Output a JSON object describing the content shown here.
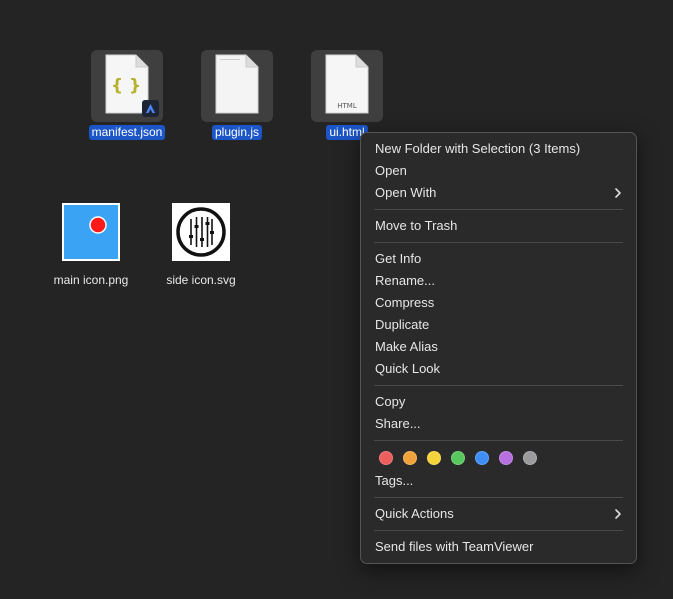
{
  "desktop": {
    "files": [
      {
        "name": "manifest.json",
        "selected": true
      },
      {
        "name": "plugin.js",
        "selected": true
      },
      {
        "name": "ui.html",
        "selected": true,
        "icon_text": "HTML"
      },
      {
        "name": "main icon.png",
        "selected": false
      },
      {
        "name": "side icon.svg",
        "selected": false
      }
    ],
    "manifest_glyph": "{ }"
  },
  "context_menu": {
    "group1": [
      {
        "label": "New Folder with Selection (3 Items)"
      },
      {
        "label": "Open"
      },
      {
        "label": "Open With",
        "submenu": true
      }
    ],
    "group2": [
      {
        "label": "Move to Trash"
      }
    ],
    "group3": [
      {
        "label": "Get Info"
      },
      {
        "label": "Rename..."
      },
      {
        "label": "Compress"
      },
      {
        "label": "Duplicate"
      },
      {
        "label": "Make Alias"
      },
      {
        "label": "Quick Look"
      }
    ],
    "group4": [
      {
        "label": "Copy"
      },
      {
        "label": "Share..."
      }
    ],
    "tag_colors": [
      {
        "name": "red",
        "color": "#ec5f5d"
      },
      {
        "name": "orange",
        "color": "#f0a33a"
      },
      {
        "name": "yellow",
        "color": "#f5d33a"
      },
      {
        "name": "green",
        "color": "#58c85e"
      },
      {
        "name": "blue",
        "color": "#3f8ef5"
      },
      {
        "name": "purple",
        "color": "#b86fe0"
      },
      {
        "name": "gray",
        "color": "#9b9b9d"
      }
    ],
    "tags_label": "Tags...",
    "group5": [
      {
        "label": "Quick Actions",
        "submenu": true
      }
    ],
    "group6": [
      {
        "label": "Send files with TeamViewer"
      }
    ]
  },
  "colors": {
    "desktop_bg": "#242424",
    "selection_blue": "#1b55c8",
    "menu_bg": "#2a2a2a"
  }
}
